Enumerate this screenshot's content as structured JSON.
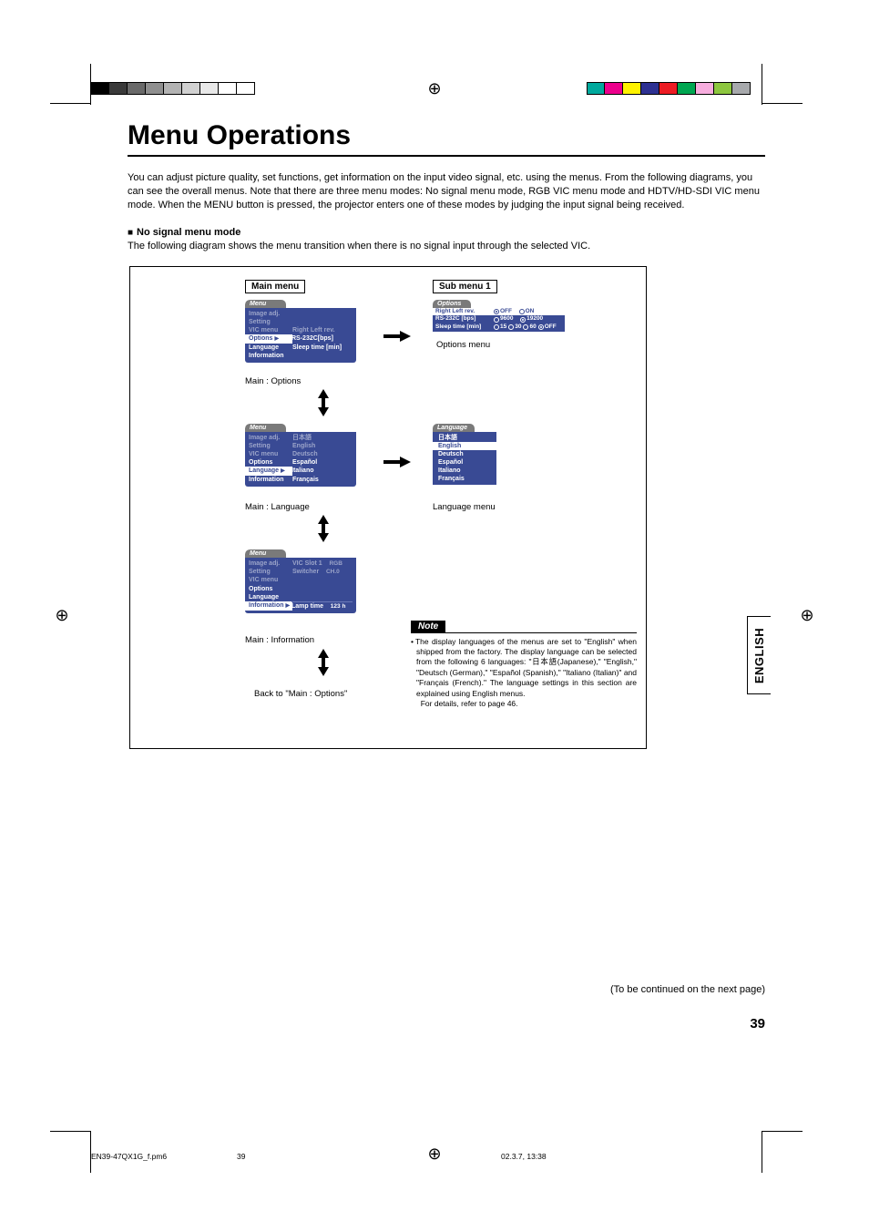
{
  "title": "Menu Operations",
  "intro": "You can adjust picture quality, set functions, get information on the input video signal, etc. using the menus. From the following diagrams, you can see the overall menus. Note that there are three menu modes: No signal menu mode, RGB VIC menu mode and HDTV/HD-SDI VIC menu mode. When the MENU button is pressed, the projector enters one of these modes by judging the input signal being received.",
  "section_head": "No signal menu mode",
  "subintro": "The following diagram shows the menu transition when there is no signal input through the selected VIC.",
  "col_main": "Main menu",
  "col_sub": "Sub menu 1",
  "menu_tab": "Menu",
  "options_tab": "Options",
  "language_tab": "Language",
  "main_items": {
    "image_adj": "Image adj.",
    "setting": "Setting",
    "vic_menu": "VIC menu",
    "options": "Options",
    "language": "Language",
    "information": "Information"
  },
  "main1_side": {
    "l1": "Right Left rev.",
    "l2": "RS-232C[bps]",
    "l3": "Sleep time [min]"
  },
  "main2_side": {
    "l1": "日本語",
    "l2": "English",
    "l3": "Deutsch",
    "l4": "Español",
    "l5": "Italiano",
    "l6": "Français"
  },
  "main3_side": {
    "l1a": "VIC Slot 1",
    "l1b": "RGB",
    "l2a": "Switcher",
    "l2b": "CH.0",
    "l3a": "Lamp time",
    "l3b": "123 h"
  },
  "caption1": "Main : Options",
  "caption2": "Main : Language",
  "caption3": "Main : Information",
  "caption_back": "Back to \"Main : Options\"",
  "sub_options": {
    "row1": {
      "label": "Right Left rev.",
      "opt1": "OFF",
      "opt2": "ON"
    },
    "row2": {
      "label": "RS-232C [bps]",
      "opt1": "9600",
      "opt2": "19200"
    },
    "row3": {
      "label": "Sleep time [min]",
      "opts": [
        "15",
        "30",
        "60",
        "OFF"
      ]
    }
  },
  "sub_options_caption": "Options menu",
  "sub_lang_caption": "Language menu",
  "languages": [
    "日本語",
    "English",
    "Deutsch",
    "Español",
    "Italiano",
    "Français"
  ],
  "note_label": "Note",
  "note_text": "The display languages of the menus are set to \"English\" when shipped from the factory. The display language can be selected from the following 6 languages: \"日本語(Japanese),\" \"English,\" \"Deutsch (German),\" \"Español (Spanish),\" \"Italiano (Italian)\" and \"Français (French).\" The language settings in this section are explained using English menus.",
  "note_text2": "For details, refer to page 46.",
  "continued": "(To be continued on the next page)",
  "pagenum": "39",
  "side_tab": "ENGLISH",
  "footer": {
    "file": "EN39-47QX1G_f.pm6",
    "mid": "39",
    "date": "02.3.7, 13:38"
  },
  "chart_data": {
    "type": "diagram",
    "description": "Menu transition diagram for No signal menu mode",
    "nodes": [
      {
        "id": "main_options",
        "label": "Main : Options",
        "column": "Main menu"
      },
      {
        "id": "main_language",
        "label": "Main : Language",
        "column": "Main menu"
      },
      {
        "id": "main_information",
        "label": "Main : Information",
        "column": "Main menu"
      },
      {
        "id": "options_menu",
        "label": "Options menu",
        "column": "Sub menu 1"
      },
      {
        "id": "language_menu",
        "label": "Language menu",
        "column": "Sub menu 1"
      }
    ],
    "edges": [
      {
        "from": "main_options",
        "to": "options_menu",
        "dir": "right"
      },
      {
        "from": "main_language",
        "to": "language_menu",
        "dir": "right"
      },
      {
        "from": "main_options",
        "to": "main_language",
        "dir": "updown"
      },
      {
        "from": "main_language",
        "to": "main_information",
        "dir": "updown"
      },
      {
        "from": "main_information",
        "to": "main_options",
        "dir": "updown",
        "label": "Back to \"Main : Options\""
      }
    ]
  }
}
